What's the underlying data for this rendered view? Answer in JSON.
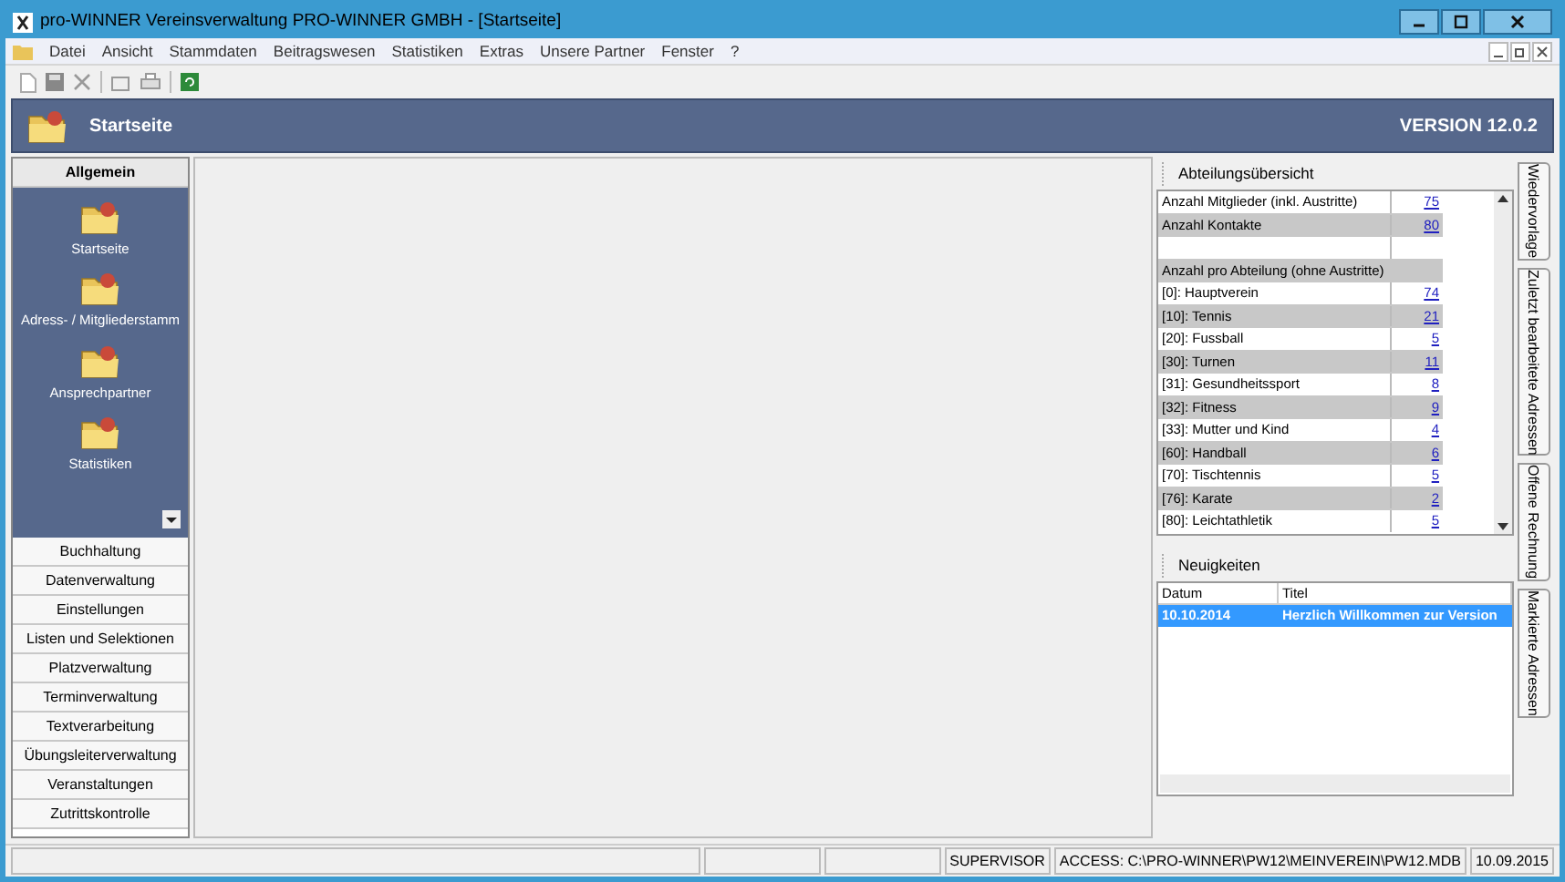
{
  "window": {
    "title": "pro-WINNER Vereinsverwaltung  PRO-WINNER GMBH - [Startseite]"
  },
  "menu": [
    "Datei",
    "Ansicht",
    "Stammdaten",
    "Beitragswesen",
    "Statistiken",
    "Extras",
    "Unsere Partner",
    "Fenster",
    "?"
  ],
  "header": {
    "title": "Startseite",
    "version": "VERSION 12.0.2"
  },
  "sidebar": [
    {
      "label": "Allgemein",
      "expanded": true,
      "items": [
        "Startseite",
        "Adress- / Mitgliederstamm",
        "Ansprechpartner",
        "Statistiken"
      ]
    },
    {
      "label": "Buchhaltung",
      "expanded": false
    },
    {
      "label": "Datenverwaltung",
      "expanded": false
    },
    {
      "label": "Einstellungen",
      "expanded": false
    },
    {
      "label": "Listen und Selektionen",
      "expanded": false
    },
    {
      "label": "Platzverwaltung",
      "expanded": false
    },
    {
      "label": "Terminverwaltung",
      "expanded": false
    },
    {
      "label": "Textverarbeitung",
      "expanded": false
    },
    {
      "label": "Übungsleiterverwaltung",
      "expanded": false
    },
    {
      "label": "Veranstaltungen",
      "expanded": false
    },
    {
      "label": "Zutrittskontrolle",
      "expanded": false
    }
  ],
  "overview": {
    "title": "Abteilungsübersicht",
    "rows": [
      {
        "kind": "count",
        "label": "Anzahl Mitglieder (inkl. Austritte)",
        "value": "75"
      },
      {
        "kind": "count",
        "label": "Anzahl Kontakte",
        "value": "80"
      },
      {
        "kind": "blank"
      },
      {
        "kind": "heading",
        "label": "Anzahl pro Abteilung (ohne Austritte)"
      },
      {
        "kind": "count",
        "label": "[0]: Hauptverein",
        "value": "74"
      },
      {
        "kind": "count",
        "label": "[10]: Tennis",
        "value": "21"
      },
      {
        "kind": "count",
        "label": "[20]: Fussball",
        "value": "5"
      },
      {
        "kind": "count",
        "label": "[30]: Turnen",
        "value": "11"
      },
      {
        "kind": "count",
        "label": "[31]: Gesundheitssport",
        "value": "8"
      },
      {
        "kind": "count",
        "label": "[32]: Fitness",
        "value": "9"
      },
      {
        "kind": "count",
        "label": "[33]: Mutter und Kind",
        "value": "4"
      },
      {
        "kind": "count",
        "label": "[60]: Handball",
        "value": "6"
      },
      {
        "kind": "count",
        "label": "[70]: Tischtennis",
        "value": "5"
      },
      {
        "kind": "count",
        "label": "[76]: Karate",
        "value": "2"
      },
      {
        "kind": "count",
        "label": "[80]: Leichtathletik",
        "value": "5"
      }
    ]
  },
  "news": {
    "title": "Neuigkeiten",
    "columns": [
      "Datum",
      "Titel"
    ],
    "rows": [
      {
        "date": "10.10.2014",
        "title": "Herzlich Willkommen zur Version",
        "selected": true
      }
    ]
  },
  "side_tabs": [
    "Wiedervorlage",
    "Zuletzt bearbeitete Adressen",
    "Offene Rechnung",
    "Markierte Adressen"
  ],
  "status_bar": [
    "SUPERVISOR",
    "ACCESS: C:\\PRO-WINNER\\PW12\\MEINVEREIN\\PW12.MDB",
    "10.09.2015"
  ]
}
